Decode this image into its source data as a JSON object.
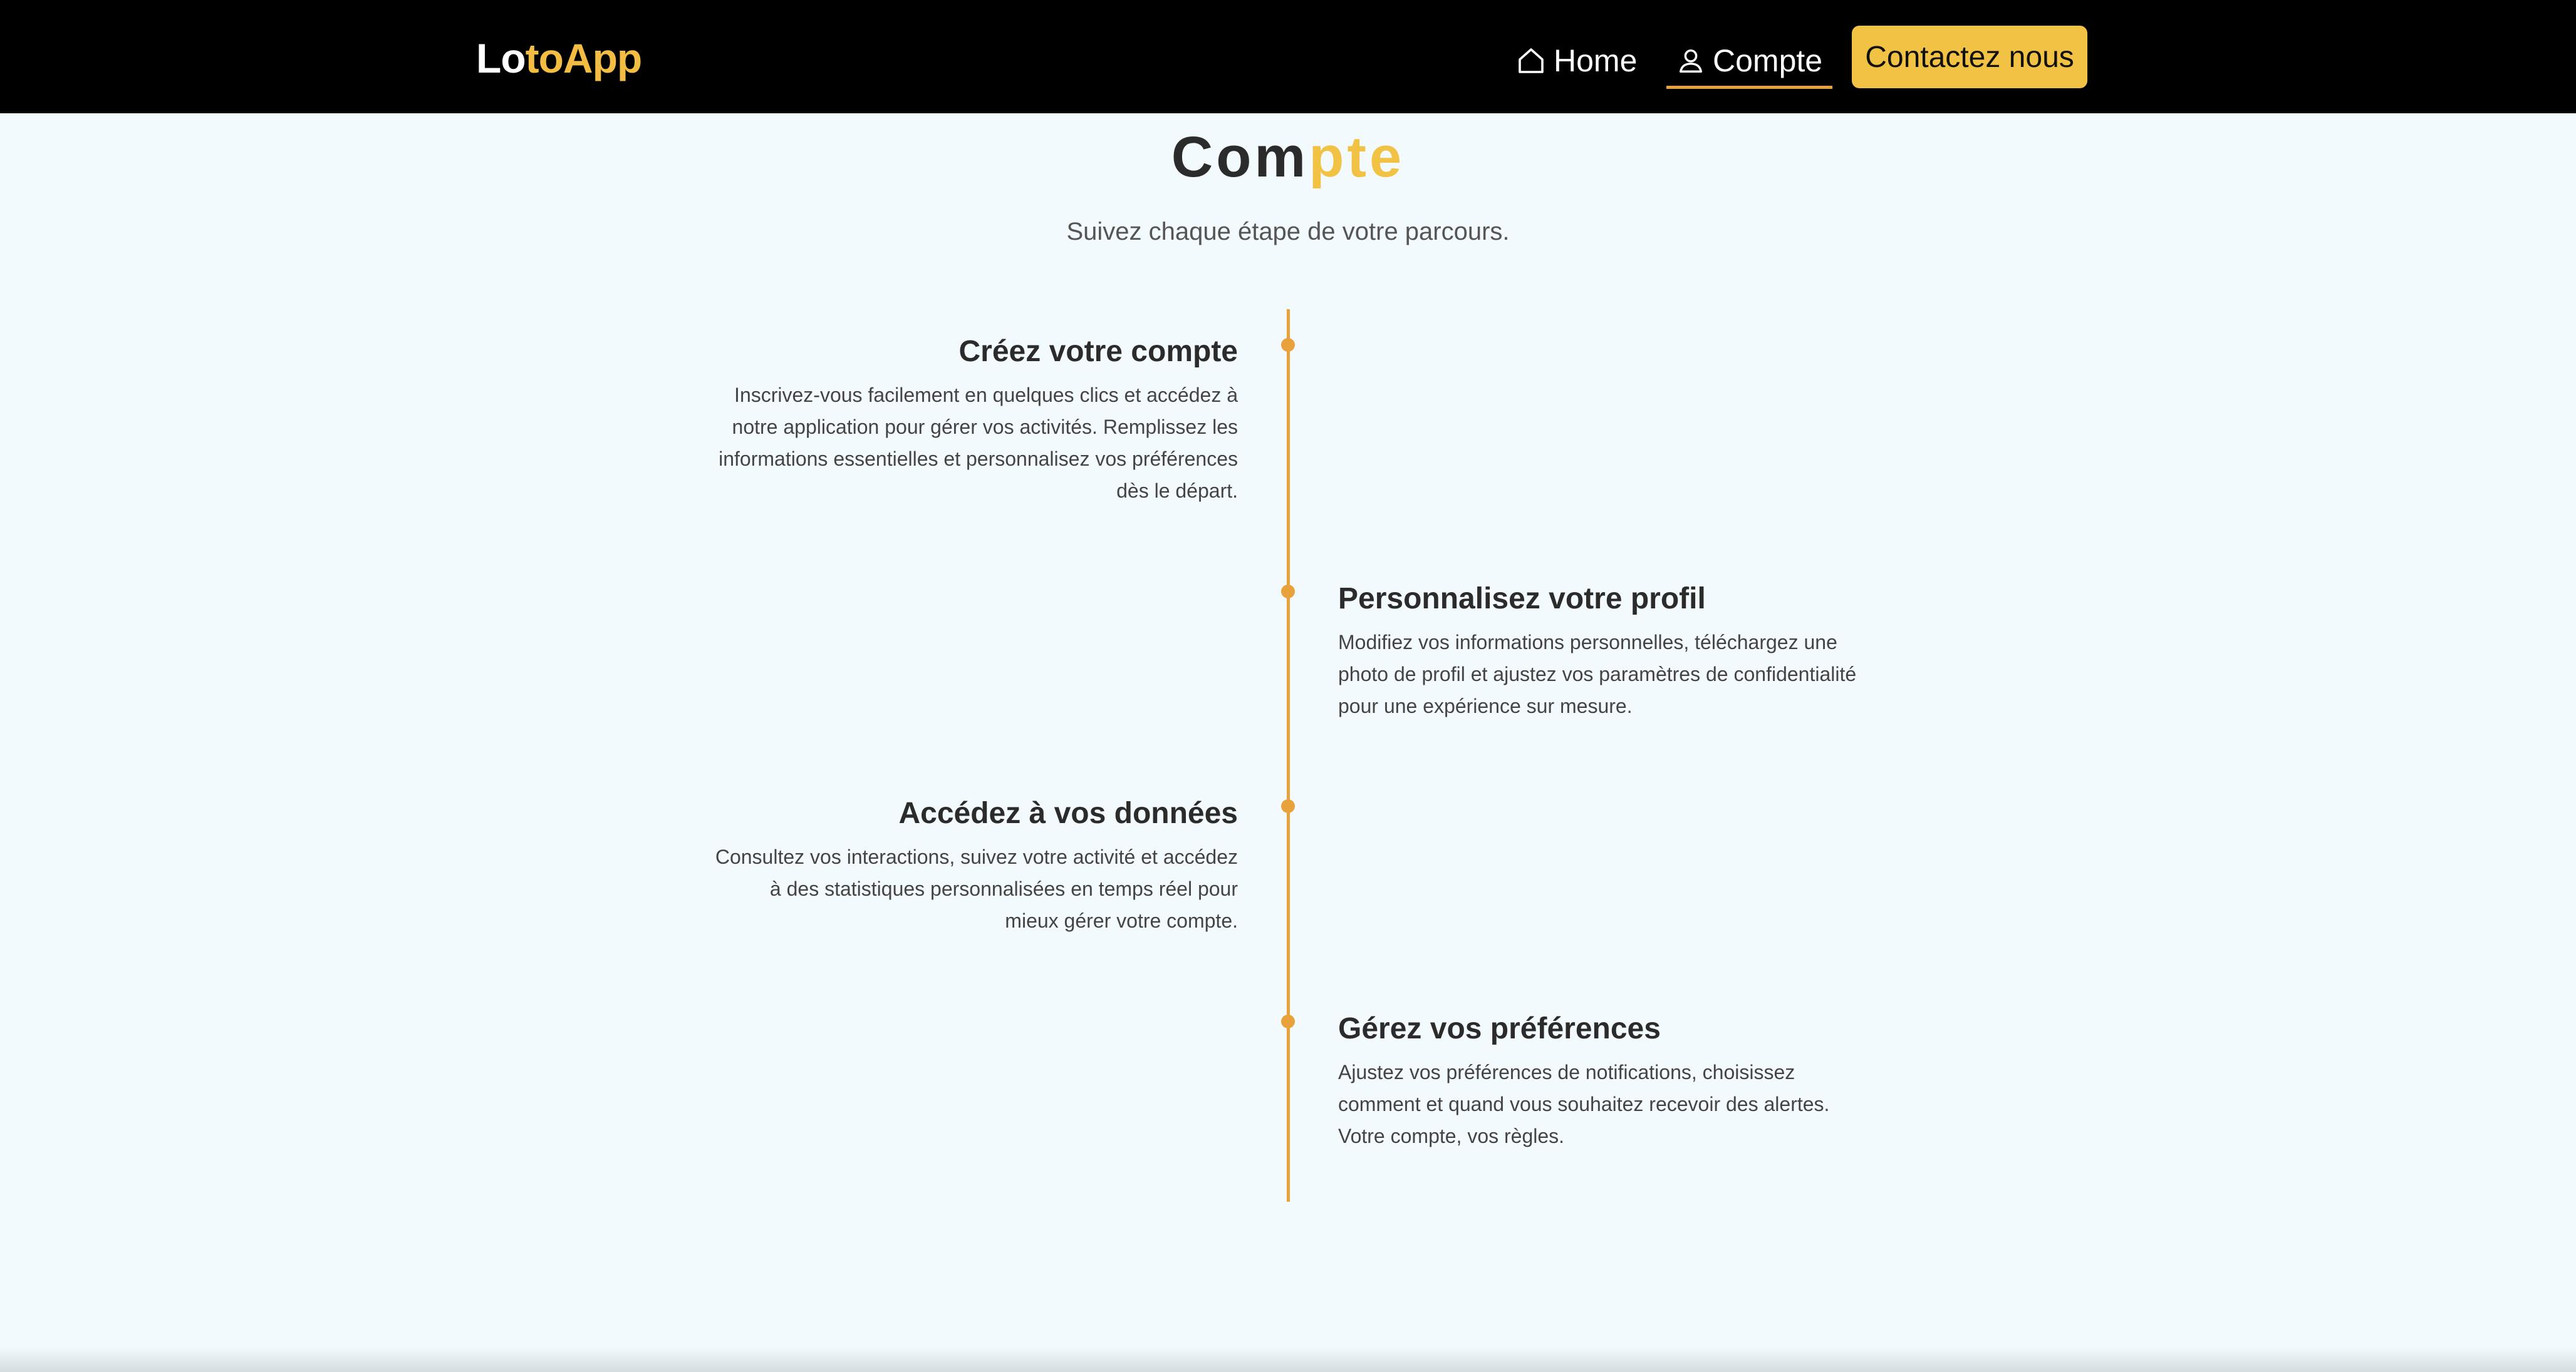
{
  "navbar": {
    "brand_part1": "Lo",
    "brand_part2": "toApp",
    "home_label": "Home",
    "compte_label": "Compte",
    "contact_label": "Contactez nous",
    "home_icon": "home-icon",
    "user_icon": "user-icon"
  },
  "hero": {
    "title_part1": "Com",
    "title_part2": "pte",
    "subtitle": "Suivez chaque étape de votre parcours."
  },
  "timeline": {
    "steps": [
      {
        "title": "Créez votre compte",
        "description": "Inscrivez-vous facilement en quelques clics et accédez à notre application pour gérer vos activités. Remplissez les informations essentielles et personnalisez vos préférences dès le départ."
      },
      {
        "title": "Personnalisez votre profil",
        "description": "Modifiez vos informations personnelles, téléchargez une photo de profil et ajustez vos paramètres de confidentialité pour une expérience sur mesure."
      },
      {
        "title": "Accédez à vos données",
        "description": "Consultez vos interactions, suivez votre activité et accédez à des statistiques personnalisées en temps réel pour mieux gérer votre compte."
      },
      {
        "title": "Gérez vos préférences",
        "description": "Ajustez vos préférences de notifications, choisissez comment et quand vous souhaitez recevoir des alertes. Votre compte, vos règles."
      }
    ]
  },
  "colors": {
    "accent": "#f2c244",
    "timeline": "#e9a23b",
    "navbar_bg": "#000000",
    "page_bg": "#f3fafd"
  }
}
